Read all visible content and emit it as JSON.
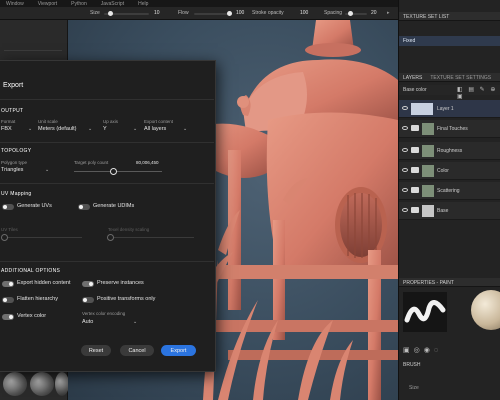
{
  "menubar": {
    "items": [
      "Window",
      "Viewport",
      "Python",
      "JavaScript",
      "Help"
    ]
  },
  "toolbar": {
    "size_label": "Size",
    "size_value": "10",
    "flow_label": "Flow",
    "flow_value": "100",
    "stroke_label": "Stroke opacity",
    "stroke_value": "100",
    "spacing_label": "Spacing",
    "spacing_value": "20"
  },
  "right_panel": {
    "texture_set_list_title": "TEXTURE SET LIST",
    "texture_set_item": "Fixed",
    "tabs": [
      "LAYERS",
      "TEXTURE SET SETTINGS"
    ],
    "base_color": "Base color",
    "layers": [
      {
        "name": "Layer 1",
        "kind": "layer"
      },
      {
        "name": "Final Touches",
        "kind": "folder"
      },
      {
        "name": "Roughness",
        "kind": "folder"
      },
      {
        "name": "Color",
        "kind": "folder"
      },
      {
        "name": "Scattering",
        "kind": "folder"
      },
      {
        "name": "Base",
        "kind": "folder"
      }
    ],
    "properties_title": "PROPERTIES - PAINT",
    "brush_label": "BRUSH",
    "brush_size_label": "Size"
  },
  "dialog": {
    "title": "Export",
    "output": {
      "title": "OUTPUT",
      "format_label": "Format",
      "format_value": "FBX",
      "unit_scale_label": "Unit scale",
      "unit_scale_value": "Meters (default)",
      "up_axis_label": "Up axis",
      "up_axis_value": "Y",
      "export_content_label": "Export content",
      "export_content_value": "All layers"
    },
    "topology": {
      "title": "TOPOLOGY",
      "polygon_type_label": "Polygon type",
      "polygon_type_value": "Triangles",
      "target_poly_label": "Target poly count",
      "target_poly_value": "80,006,450",
      "target_poly_fraction": 0.45
    },
    "uv": {
      "title": "UV Mapping",
      "generate_uvs": "Generate UVs",
      "generate_udims": "Generate UDIMs",
      "uv_tiles_label": "UV Tiles",
      "texel_density_label": "Texel density scaling"
    },
    "additional": {
      "title": "ADDITIONAL OPTIONS",
      "export_hidden": "Export hidden content",
      "preserve_instances": "Preserve instances",
      "flatten_hierarchy": "Flatten hierarchy",
      "positive_transforms": "Positive transforms only",
      "vertex_color": "Vertex color",
      "vertex_color_encoding_label": "Vertex color encoding",
      "vertex_color_encoding_value": "Auto"
    },
    "buttons": {
      "reset": "Reset",
      "cancel": "Cancel",
      "export": "Export"
    }
  },
  "colors": {
    "accent": "#2b74e0",
    "viewport_bg": "#3a4d5e",
    "model": "#d47a68",
    "dialog_bg": "#1f1f1f"
  }
}
